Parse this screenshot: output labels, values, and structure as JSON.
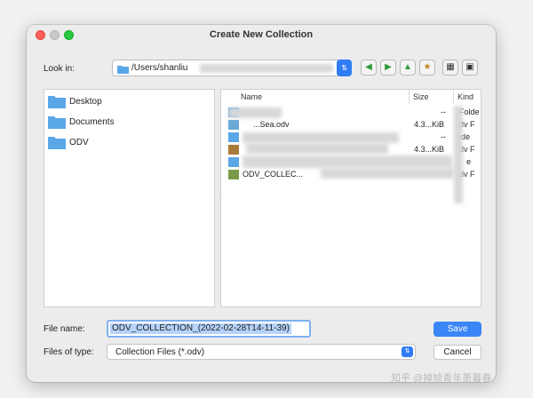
{
  "window": {
    "title": "Create New Collection"
  },
  "look_in": {
    "label": "Look in:",
    "path": "/Users/shanliu"
  },
  "toolbar": {
    "icons": [
      "back-icon",
      "forward-icon",
      "up-icon",
      "new-folder-icon",
      "list-view-icon",
      "detail-view-icon"
    ]
  },
  "places": [
    {
      "label": "Desktop"
    },
    {
      "label": "Documents"
    },
    {
      "label": "ODV"
    }
  ],
  "file_list": {
    "columns": [
      "Name",
      "Size",
      "Kind"
    ],
    "rows": [
      {
        "name": "",
        "size": "--",
        "kind": "Folde"
      },
      {
        "name": "...Sea.odv",
        "size": "4.3...KiB",
        "kind": "dv F"
      },
      {
        "name": "",
        "size": "--",
        "kind": "ide"
      },
      {
        "name": "",
        "size": "4.3...KiB",
        "kind": "dv F"
      },
      {
        "name": "",
        "size": "",
        "kind": "e"
      },
      {
        "name": "ODV_COLLEC...",
        "size": "",
        "kind": "dv F"
      }
    ]
  },
  "file_name": {
    "label": "File name:",
    "value": "ODV_COLLECTION_(2022-02-28T14-11-39)"
  },
  "file_type": {
    "label": "Files of type:",
    "value": "Collection Files (*.odv)"
  },
  "buttons": {
    "save": "Save",
    "cancel": "Cancel"
  },
  "watermark": "知乎 @掉帧青年萧暮春",
  "colors": {
    "accent": "#3a86f7",
    "selection": "#b5d3fb",
    "folder": "#5aa7e8"
  }
}
